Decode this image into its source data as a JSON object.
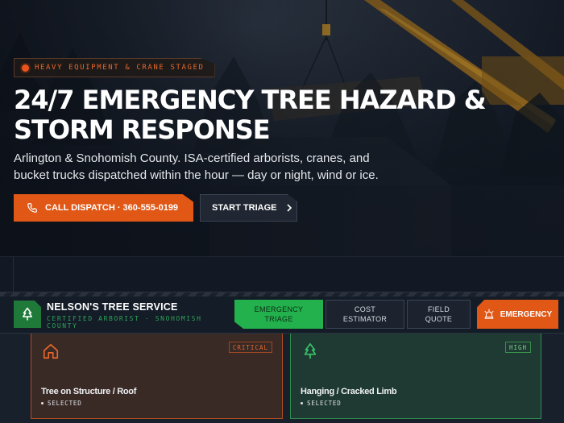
{
  "hero": {
    "tag": "HEAVY EQUIPMENT & CRANE STAGED",
    "title_line1": "24/7 EMERGENCY TREE HAZARD &",
    "title_line2": "STORM RESPONSE",
    "subtitle": "Arlington & Snohomish County. ISA-certified arborists, cranes, and bucket trucks dispatched within the hour — day or night, wind or ice.",
    "call_label": "CALL DISPATCH · 360-555-0199",
    "triage_label": "START TRIAGE",
    "call_icon": "phone-icon",
    "triage_icon": "chevron-right-icon"
  },
  "nav": {
    "brand_name": "NELSON'S TREE SERVICE",
    "brand_meta": "CERTIFIED ARBORIST · SNOHOMISH COUNTY",
    "logo_icon": "tree-icon",
    "tabs": [
      {
        "line1": "EMERGENCY",
        "line2": "TRIAGE",
        "active": true
      },
      {
        "line1": "COST",
        "line2": "ESTIMATOR",
        "active": false
      },
      {
        "line1": "FIELD",
        "line2": "QUOTE",
        "active": false
      }
    ],
    "emergency_label": "EMERGENCY",
    "emergency_icon": "siren-icon"
  },
  "cards": [
    {
      "title": "Tree on Structure / Roof",
      "badge": "CRITICAL",
      "status": "SELECTED",
      "icon": "house-icon"
    },
    {
      "title": "Hanging / Cracked Limb",
      "badge": "HIGH",
      "status": "SELECTED",
      "icon": "tree-icon"
    }
  ],
  "colors": {
    "accent_orange": "#e05716",
    "accent_green": "#22b14c",
    "background": "#10161f"
  }
}
